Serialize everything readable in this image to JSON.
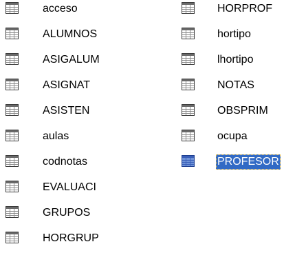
{
  "icon": "table-icon",
  "colors": {
    "selection_background": "#316ac5",
    "selection_text": "#ffffff"
  },
  "columns": [
    {
      "items": [
        {
          "label": "acceso",
          "selected": false
        },
        {
          "label": "ALUMNOS",
          "selected": false
        },
        {
          "label": "ASIGALUM",
          "selected": false
        },
        {
          "label": "ASIGNAT",
          "selected": false
        },
        {
          "label": "ASISTEN",
          "selected": false
        },
        {
          "label": "aulas",
          "selected": false
        },
        {
          "label": "codnotas",
          "selected": false
        },
        {
          "label": "EVALUACI",
          "selected": false
        },
        {
          "label": "GRUPOS",
          "selected": false
        },
        {
          "label": "HORGRUP",
          "selected": false
        }
      ]
    },
    {
      "items": [
        {
          "label": "HORPROF",
          "selected": false
        },
        {
          "label": "hortipo",
          "selected": false
        },
        {
          "label": "lhortipo",
          "selected": false
        },
        {
          "label": "NOTAS",
          "selected": false
        },
        {
          "label": "OBSPRIM",
          "selected": false
        },
        {
          "label": "ocupa",
          "selected": false
        },
        {
          "label": "PROFESOR",
          "selected": true
        }
      ]
    }
  ]
}
